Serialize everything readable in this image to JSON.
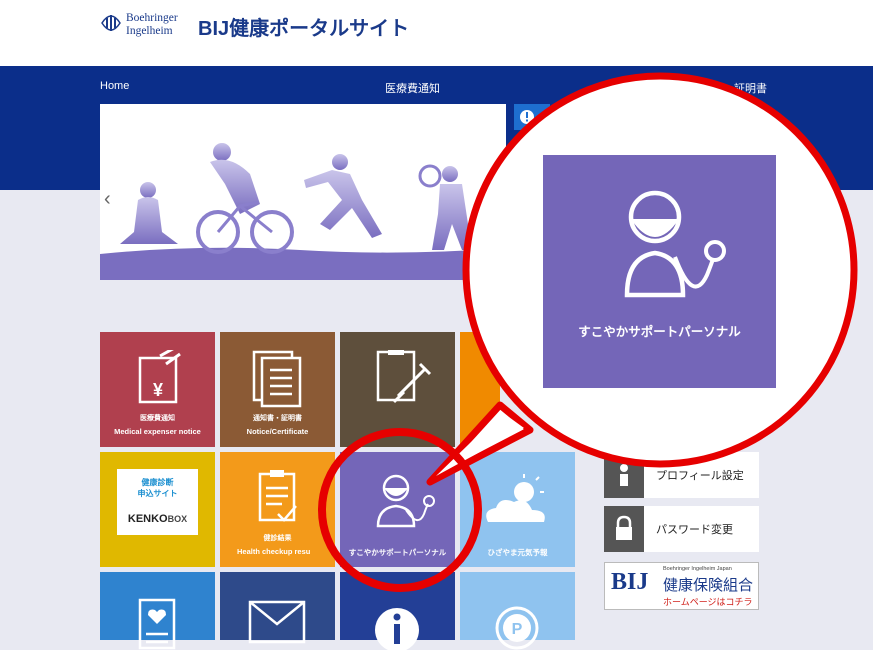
{
  "header": {
    "logo_line1": "Boehringer",
    "logo_line2": "Ingelheim",
    "site_title": "BIJ健康ポータルサイト"
  },
  "nav": {
    "home": "Home",
    "medical": "医療費通知",
    "notice": "通知書・証明書"
  },
  "tiles": {
    "medical": {
      "l1": "医療費通知",
      "l2": "Medical expenser notice",
      "color": "#b0404e"
    },
    "notice": {
      "l1": "通知書・証明書",
      "l2": "Notice/Certificate",
      "color": "#8b5a35"
    },
    "kenko": {
      "line1": "健康診断",
      "line2": "申込サイト",
      "brand_a": "KENKO",
      "brand_b": "BOX",
      "color": "#e0b800"
    },
    "checkup": {
      "l1": "健診結果",
      "l2": "Health checkup resu",
      "color": "#f39a1a"
    },
    "sukoyaka": {
      "l2": "すこやかサポートパーソナル",
      "color": "#7466b8"
    },
    "weather": {
      "l2": "ひざやま元気予報",
      "color": "#8fc3ef"
    }
  },
  "side": {
    "profile": "プロフィール設定",
    "password": "パスワード変更",
    "bij_eng": "Boehringer Ingelheim Japan",
    "bij_mark": "BIJ",
    "bij_jp": "健康保険組合",
    "bij_link": "ホームページはコチラ"
  },
  "zoom": {
    "label": "すこやかサポートパーソナル"
  }
}
